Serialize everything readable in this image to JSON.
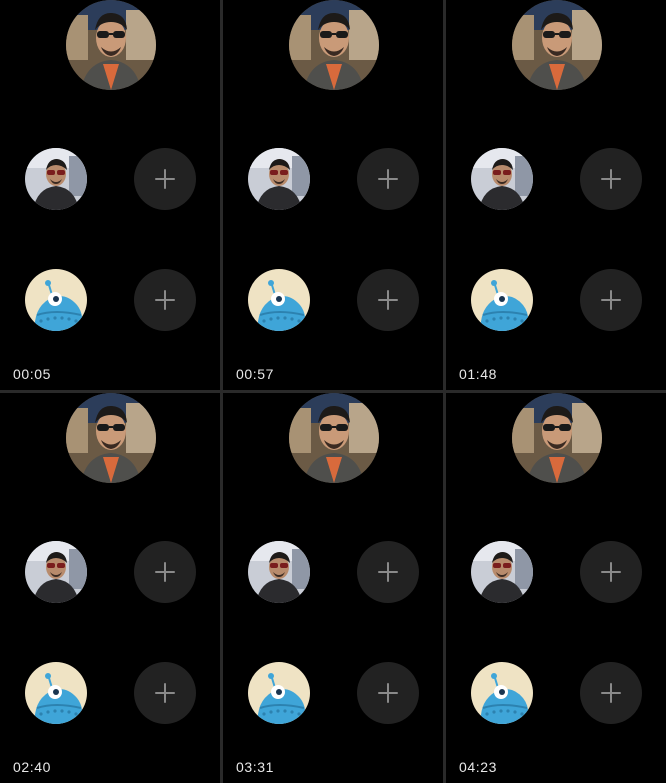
{
  "panels": [
    {
      "timer": "00:05"
    },
    {
      "timer": "00:57"
    },
    {
      "timer": "01:48"
    },
    {
      "timer": "02:40"
    },
    {
      "timer": "03:31"
    },
    {
      "timer": "04:23"
    }
  ],
  "icons": {
    "main_avatar": "person-photo",
    "small_avatar": "person-photo",
    "monster_avatar": "blue-monster-avatar",
    "add": "plus-icon"
  },
  "colors": {
    "background": "#000000",
    "divider": "#2a2a2a",
    "button_bg": "#222222",
    "plus": "#8a8a8a",
    "timer_text": "#e8e8e8",
    "monster_blue": "#3fa5d8",
    "monster_bg": "#efe3c4"
  }
}
